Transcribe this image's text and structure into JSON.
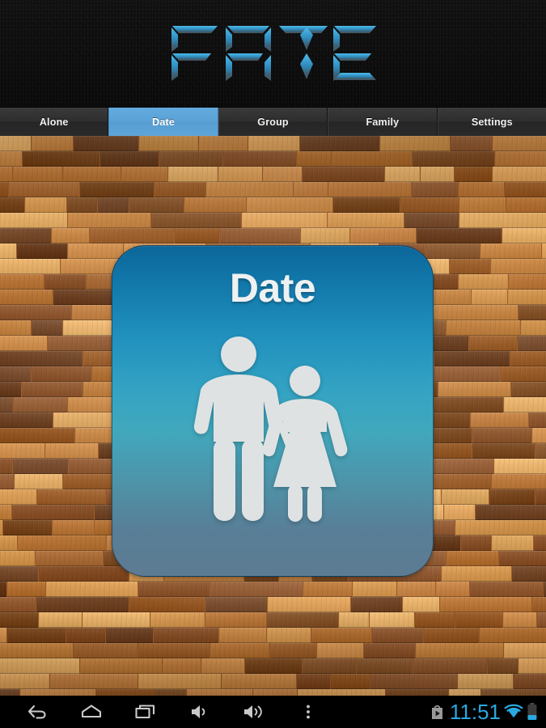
{
  "app": {
    "title": "FATE",
    "logo_gradient_top": "#3eaadf",
    "logo_gradient_bottom": "#3b4f5e"
  },
  "tabs": {
    "selected_index": 1,
    "items": [
      {
        "label": "Alone",
        "selected": false
      },
      {
        "label": "Date",
        "selected": true
      },
      {
        "label": "Group",
        "selected": false
      },
      {
        "label": "Family",
        "selected": false
      },
      {
        "label": "Settings",
        "selected": false
      }
    ]
  },
  "card": {
    "title": "Date",
    "icon": "couple-icon",
    "gradient_top": "#0c6699",
    "gradient_mid": "#41a8bd",
    "gradient_bottom": "#5d7b92",
    "figure_color": "#dfe2e3"
  },
  "background": {
    "texture": "wood-plank-texture",
    "colors": [
      "#d89a52",
      "#b97536",
      "#9a5b26",
      "#7d4a20",
      "#6b3e1f",
      "#c98744",
      "#e0a961",
      "#8a5128"
    ]
  },
  "navbar": {
    "buttons": [
      {
        "name": "back-icon",
        "label": "Back"
      },
      {
        "name": "home-icon",
        "label": "Home"
      },
      {
        "name": "recents-icon",
        "label": "Recent apps"
      },
      {
        "name": "volume-down-icon",
        "label": "Volume down"
      },
      {
        "name": "volume-up-icon",
        "label": "Volume up"
      },
      {
        "name": "overflow-menu-icon",
        "label": "Menu"
      }
    ],
    "status": {
      "play-store-icon": "Play Store",
      "clock": "11:51",
      "wifi-icon": "Wi-Fi connected",
      "battery-icon": "Battery low",
      "accent_color": "#2aa8e0"
    }
  }
}
